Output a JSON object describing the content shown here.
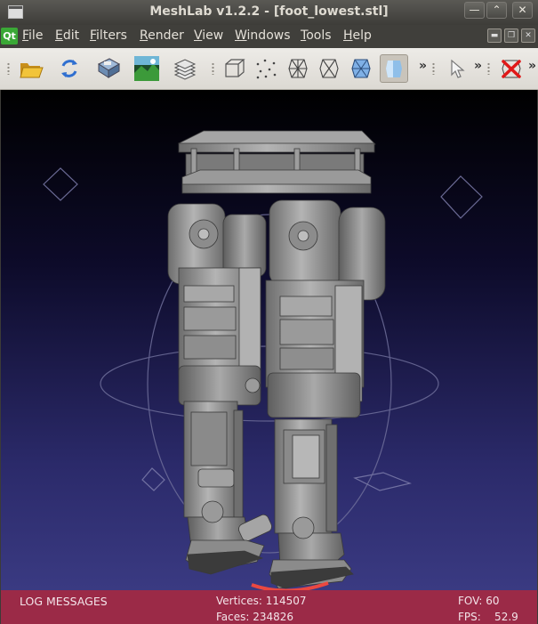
{
  "window": {
    "title": "MeshLab v1.2.2 - [foot_lowest.stl]",
    "controls": {
      "minimize": "—",
      "maximize": "⌃",
      "close": "✕"
    }
  },
  "menubar": {
    "logo": "Qt",
    "items": [
      {
        "label": "File",
        "mnemonic": "F",
        "rest": "ile"
      },
      {
        "label": "Edit",
        "mnemonic": "E",
        "rest": "dit"
      },
      {
        "label": "Filters",
        "mnemonic": "F",
        "rest": "ilters"
      },
      {
        "label": "Render",
        "mnemonic": "R",
        "rest": "ender"
      },
      {
        "label": "View",
        "mnemonic": "V",
        "rest": "iew"
      },
      {
        "label": "Windows",
        "mnemonic": "W",
        "rest": "indows"
      },
      {
        "label": "Tools",
        "mnemonic": "T",
        "rest": "ools"
      },
      {
        "label": "Help",
        "mnemonic": "H",
        "rest": "elp"
      }
    ]
  },
  "toolbar": {
    "icons": [
      "open-folder-icon",
      "reload-icon",
      "save-icon",
      "snapshot-icon",
      "layers-icon",
      "bbox-icon",
      "points-icon",
      "wireframe-icon",
      "hidden-lines-icon",
      "flat-lines-icon",
      "smooth-icon",
      "select-icon",
      "delete-icon"
    ],
    "overflow": "»"
  },
  "status": {
    "log": "LOG MESSAGES",
    "vertices": "Vertices: 114507",
    "faces": "Faces: 234826",
    "fov": "FOV: 60",
    "fps": "FPS:    52.9"
  },
  "colors": {
    "status_bg": "#9b2a47",
    "mesh": "#8f8f8f",
    "active_tool": "#c9c4bb"
  }
}
